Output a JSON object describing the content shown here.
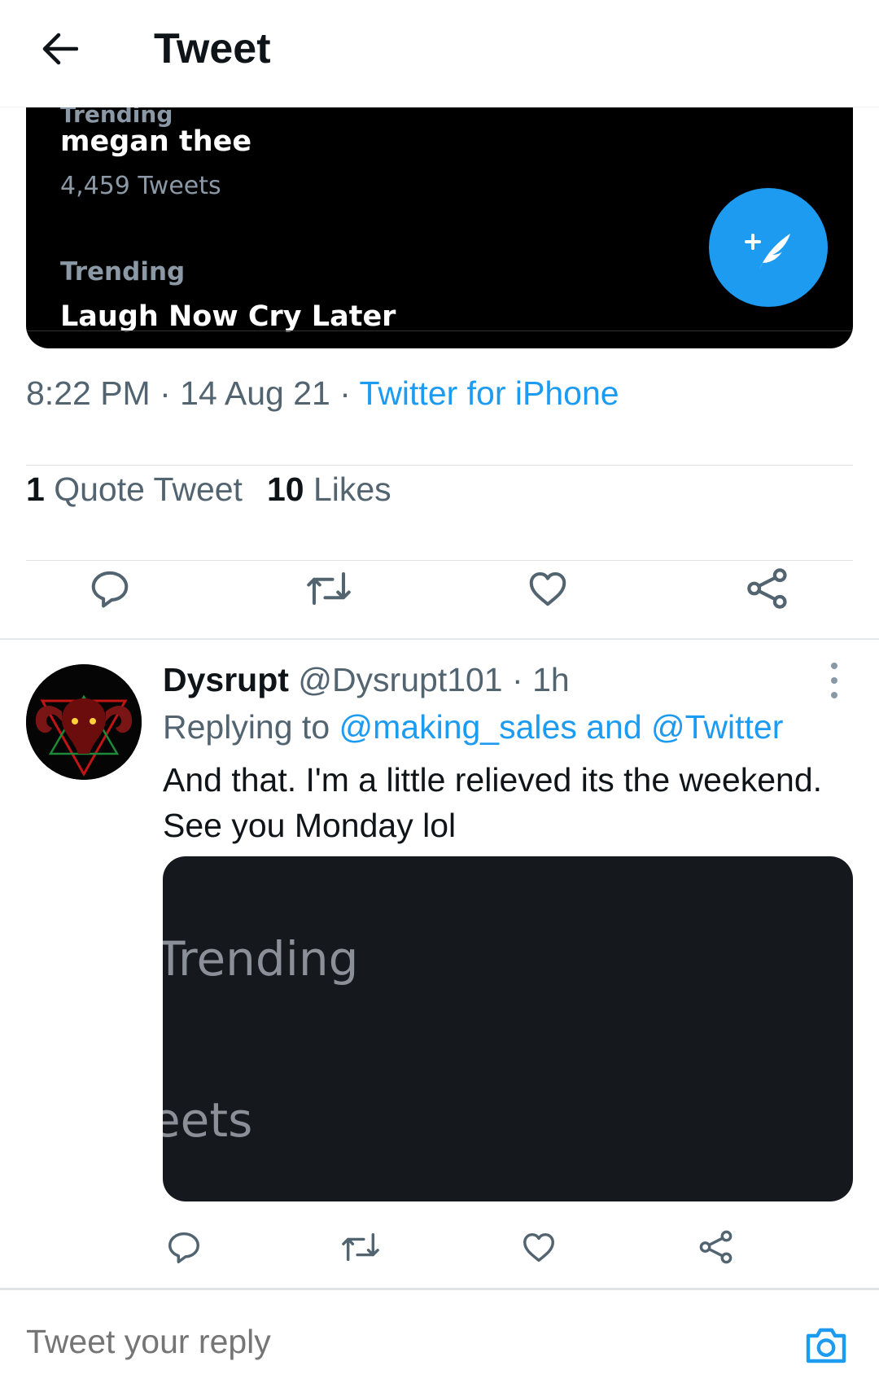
{
  "header": {
    "title": "Tweet",
    "back_icon": "arrow-left-icon"
  },
  "media": {
    "partial_label": "Trending",
    "trend_1_name": "megan thee",
    "trend_1_count": "4,459 Tweets",
    "trend_2_label": "Trending",
    "trend_2_name": "Laugh Now Cry Later",
    "compose_fab_icon": "compose-tweet-icon"
  },
  "meta": {
    "time": "8:22 PM",
    "separator": " · ",
    "date": "14 Aug 21",
    "source": "Twitter for iPhone"
  },
  "stats": {
    "quote_count": "1",
    "quote_label": "Quote Tweet",
    "likes_count": "10",
    "likes_label": "Likes"
  },
  "actions": {
    "icons": [
      "reply-icon",
      "retweet-icon",
      "like-icon",
      "share-icon"
    ]
  },
  "reply": {
    "name": "Dysrupt",
    "handle": "@Dysrupt101",
    "dot": " · ",
    "time": "1h",
    "replying_prefix": "Replying to ",
    "mentions": "@making_sales and @Twitter",
    "text": "And that. I'm a little relieved its the weekend. See you Monday lol",
    "media_text_1": "Trending",
    "media_text_2": "eets"
  },
  "compose": {
    "placeholder": "Tweet your reply",
    "camera_icon": "camera-icon"
  },
  "colors": {
    "accent": "#1d9bf0",
    "text_primary": "#0f1419",
    "text_secondary": "#536471"
  }
}
